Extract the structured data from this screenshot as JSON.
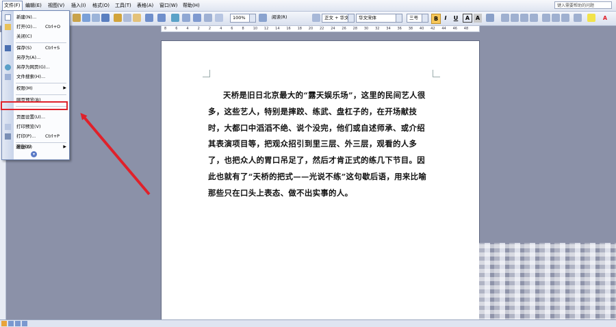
{
  "menubar": {
    "items": [
      {
        "label": "文件(F)"
      },
      {
        "label": "编辑(E)"
      },
      {
        "label": "视图(V)"
      },
      {
        "label": "插入(I)"
      },
      {
        "label": "格式(O)"
      },
      {
        "label": "工具(T)"
      },
      {
        "label": "表格(A)"
      },
      {
        "label": "窗口(W)"
      },
      {
        "label": "帮助(H)"
      }
    ],
    "help_placeholder": "键入需要帮助的问题"
  },
  "toolbar": {
    "zoom": "100%",
    "read_label": "阅读(R)",
    "style": "正文 + 华文",
    "font": "华文宋体",
    "size": "三号",
    "bold": "B",
    "italic": "I",
    "underline": "U",
    "charborder": "A",
    "charshade": "A"
  },
  "ruler": {
    "labels": [
      "8",
      "6",
      "4",
      "2",
      "2",
      "4",
      "6",
      "8",
      "10",
      "12",
      "14",
      "16",
      "18",
      "20",
      "22",
      "24",
      "26",
      "28",
      "30",
      "32",
      "34",
      "36",
      "38",
      "40",
      "42",
      "44",
      "46",
      "48"
    ]
  },
  "file_menu": {
    "items": [
      {
        "label": "新建(N)...",
        "shortcut": ""
      },
      {
        "label": "打开(O)...",
        "shortcut": "Ctrl+O"
      },
      {
        "label": "关闭(C)",
        "shortcut": ""
      },
      {
        "label": "保存(S)",
        "shortcut": "Ctrl+S"
      },
      {
        "label": "另存为(A)...",
        "shortcut": ""
      },
      {
        "label": "另存为网页(G)...",
        "shortcut": ""
      },
      {
        "label": "文件搜索(H)...",
        "shortcut": ""
      },
      {
        "label": "权限(M)",
        "shortcut": ""
      },
      {
        "label": "网页预览(B)",
        "shortcut": ""
      },
      {
        "label": "页面设置(U)...",
        "shortcut": ""
      },
      {
        "label": "打印预览(V)",
        "shortcut": ""
      },
      {
        "label": "打印(P)...",
        "shortcut": "Ctrl+P"
      },
      {
        "label": "发送(D)",
        "shortcut": ""
      },
      {
        "label": "退出(X)",
        "shortcut": ""
      }
    ],
    "highlighted_index": 9,
    "highlight_color": "#e0212a"
  },
  "document": {
    "paragraph": "天桥是旧日北京最大的“露天娱乐场”，这里的民间艺人很多，这些艺人，特别是摔跤、练武、盘杠子的，在开场献技时，大都口中滔滔不绝、说个没完，他们或自述师承、或介绍其表演项目等，把观众招引到里三层、外三层，观看的人多了，也把众人的胃口吊足了，然后才肯正式的练几下节目。因此也就有了“天桥的把式——光说不练”这句歇后语，用来比喻那些只在口头上表态、做不出实事的人。"
  },
  "annotation": {
    "arrow_color": "#e0212a"
  }
}
